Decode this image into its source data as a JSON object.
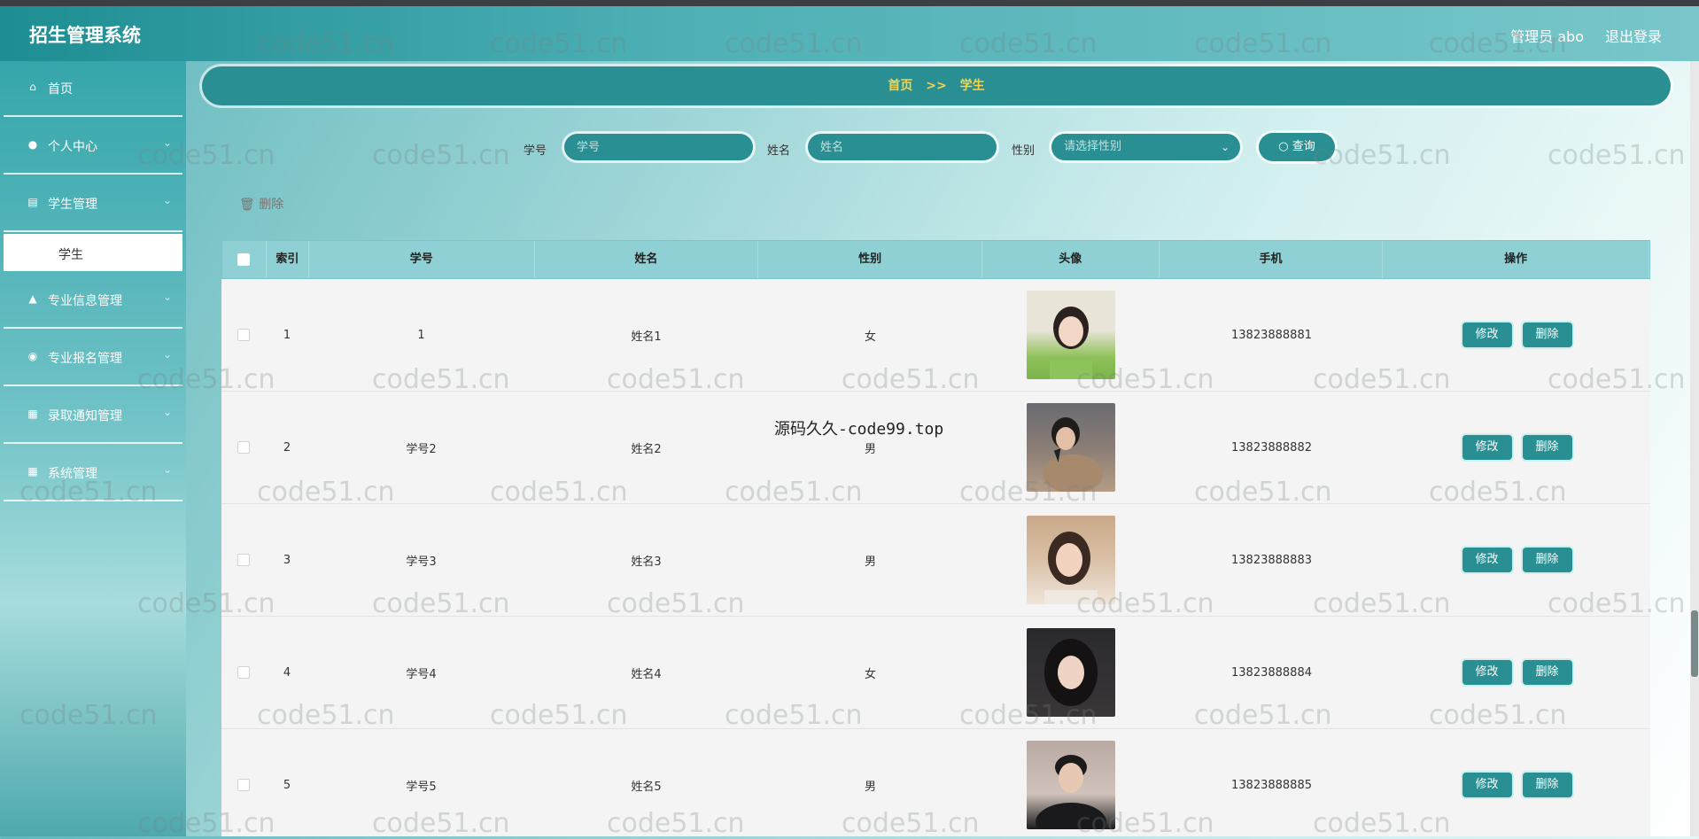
{
  "header": {
    "app_title": "招生管理系统",
    "admin_label": "管理员 abo",
    "logout_label": "退出登录"
  },
  "sidebar": {
    "items": [
      {
        "label": "首页",
        "icon": "home-icon"
      },
      {
        "label": "个人中心",
        "icon": "user-icon"
      },
      {
        "label": "学生管理",
        "icon": "briefcase-icon"
      },
      {
        "label": "专业信息管理",
        "icon": "thumbs-up-icon"
      },
      {
        "label": "专业报名管理",
        "icon": "map-pin-icon"
      },
      {
        "label": "录取通知管理",
        "icon": "grid-icon"
      },
      {
        "label": "系统管理",
        "icon": "grid-icon"
      }
    ],
    "active_sub_item": "学生"
  },
  "breadcrumb": {
    "home": "首页",
    "separator": ">>",
    "current": "学生"
  },
  "search": {
    "student_id_label": "学号",
    "student_id_placeholder": "学号",
    "name_label": "姓名",
    "name_placeholder": "姓名",
    "gender_label": "性别",
    "gender_placeholder": "请选择性别",
    "query_label": "查询"
  },
  "toolbar": {
    "bulk_delete_label": "删除"
  },
  "table": {
    "headers": [
      "索引",
      "学号",
      "姓名",
      "性别",
      "头像",
      "手机",
      "操作"
    ],
    "rows": [
      {
        "index": "1",
        "student_id": "1",
        "name": "姓名1",
        "gender": "女",
        "phone": "13823888881"
      },
      {
        "index": "2",
        "student_id": "学号2",
        "name": "姓名2",
        "gender": "男",
        "phone": "13823888882"
      },
      {
        "index": "3",
        "student_id": "学号3",
        "name": "姓名3",
        "gender": "男",
        "phone": "13823888883"
      },
      {
        "index": "4",
        "student_id": "学号4",
        "name": "姓名4",
        "gender": "女",
        "phone": "13823888884"
      },
      {
        "index": "5",
        "student_id": "学号5",
        "name": "姓名5",
        "gender": "男",
        "phone": "13823888885"
      }
    ],
    "edit_label": "修改",
    "delete_label": "删除"
  },
  "watermarks": {
    "overlay_text": "源码久久-code99.top",
    "tile_text": "code51.cn"
  }
}
